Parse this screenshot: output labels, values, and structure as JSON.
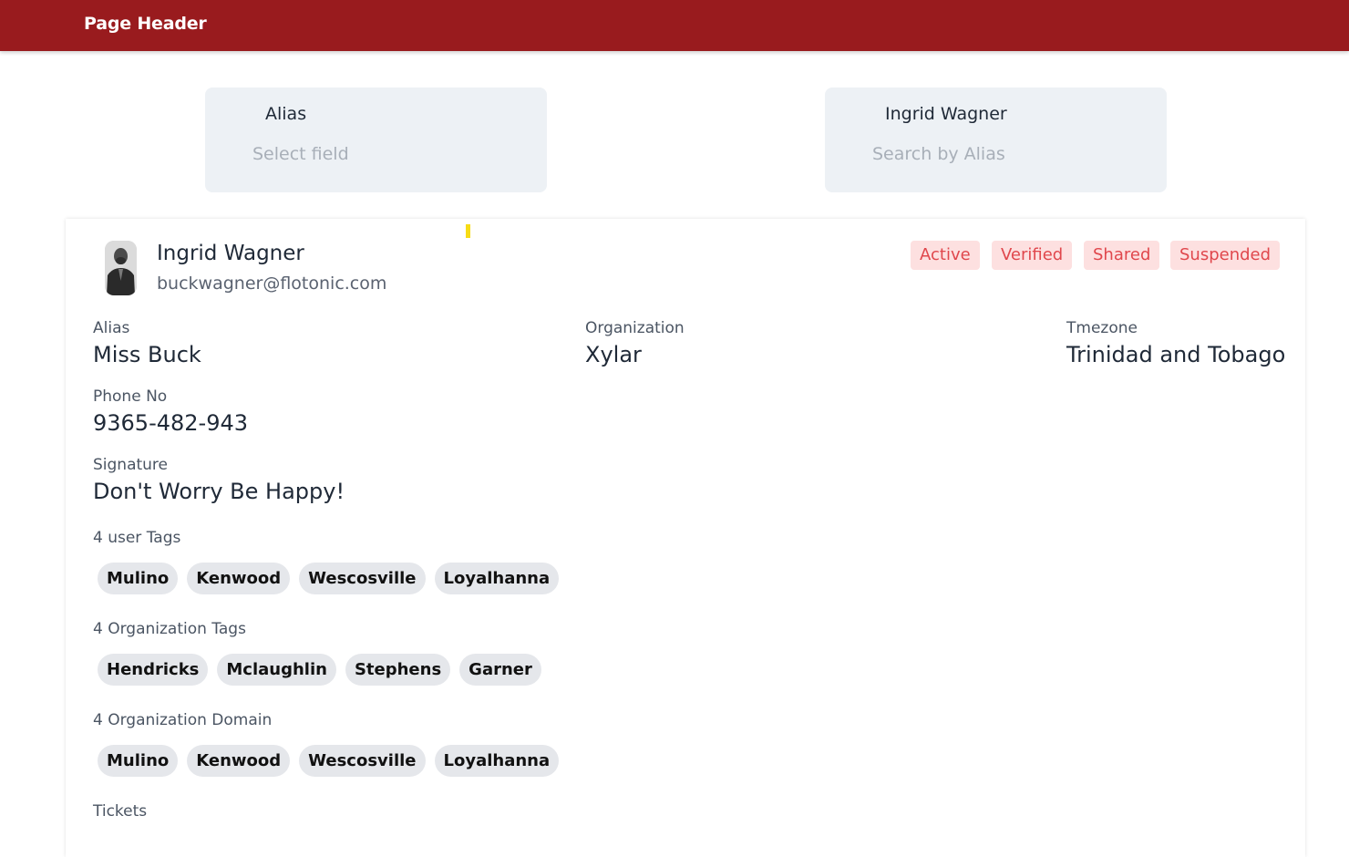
{
  "header": {
    "title": "Page Header"
  },
  "filters": {
    "field": {
      "value": "Alias",
      "placeholder": "Select field"
    },
    "search": {
      "value": "Ingrid Wagner",
      "placeholder": "Search by Alias"
    }
  },
  "profile": {
    "name": "Ingrid Wagner",
    "email": "buckwagner@flotonic.com",
    "avatar_icon": "user-photo",
    "badges": [
      "Active",
      "Verified",
      "Shared",
      "Suspended"
    ]
  },
  "fields": {
    "alias": {
      "label": "Alias",
      "value": "Miss Buck"
    },
    "organization": {
      "label": "Organization",
      "value": "Xylar"
    },
    "timezone": {
      "label": "Tmezone",
      "value": "Trinidad and Tobago"
    },
    "phone": {
      "label": "Phone No",
      "value": "9365-482-943"
    },
    "signature": {
      "label": "Signature",
      "value": "Don't Worry Be Happy!"
    }
  },
  "user_tags": {
    "label": "4 user Tags",
    "items": [
      "Mulino",
      "Kenwood",
      "Wescosville",
      "Loyalhanna"
    ]
  },
  "org_tags": {
    "label": "4 Organization Tags",
    "items": [
      "Hendricks",
      "Mclaughlin",
      "Stephens",
      "Garner"
    ]
  },
  "org_domains": {
    "label": "4 Organization Domain",
    "items": [
      "Mulino",
      "Kenwood",
      "Wescosville",
      "Loyalhanna"
    ]
  },
  "tickets": {
    "label": "Tickets"
  },
  "colors": {
    "header_bg": "#991b1e",
    "badge_bg": "#fde0e0",
    "badge_text": "#e0474c",
    "tag_bg": "#e5e7eb",
    "filter_bg": "#edf1f5"
  }
}
